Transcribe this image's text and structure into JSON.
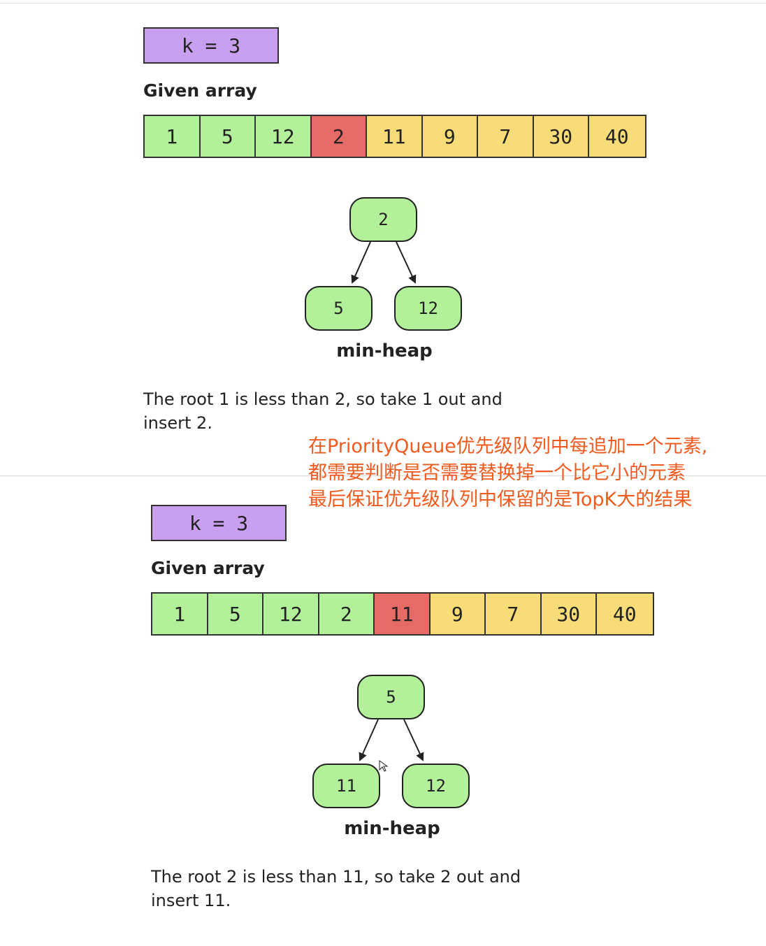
{
  "panels": [
    {
      "k_label": "k = 3",
      "given_label": "Given array",
      "array": [
        {
          "value": "1",
          "color": "green"
        },
        {
          "value": "5",
          "color": "green"
        },
        {
          "value": "12",
          "color": "green"
        },
        {
          "value": "2",
          "color": "red"
        },
        {
          "value": "11",
          "color": "yellow"
        },
        {
          "value": "9",
          "color": "yellow"
        },
        {
          "value": "7",
          "color": "yellow"
        },
        {
          "value": "30",
          "color": "yellow"
        },
        {
          "value": "40",
          "color": "yellow"
        }
      ],
      "heap": {
        "root": "2",
        "left": "5",
        "right": "12",
        "caption": "min-heap"
      },
      "description_line1": "The root 1 is less than 2, so take 1 out and",
      "description_line2": "insert 2."
    },
    {
      "k_label": "k = 3",
      "given_label": "Given array",
      "array": [
        {
          "value": "1",
          "color": "green"
        },
        {
          "value": "5",
          "color": "green"
        },
        {
          "value": "12",
          "color": "green"
        },
        {
          "value": "2",
          "color": "green"
        },
        {
          "value": "11",
          "color": "red"
        },
        {
          "value": "9",
          "color": "yellow"
        },
        {
          "value": "7",
          "color": "yellow"
        },
        {
          "value": "30",
          "color": "yellow"
        },
        {
          "value": "40",
          "color": "yellow"
        }
      ],
      "heap": {
        "root": "5",
        "left": "11",
        "right": "12",
        "caption": "min-heap"
      },
      "description_line1": "The root 2 is less than 11, so take 2 out and",
      "description_line2": "insert 11."
    }
  ],
  "annotation": {
    "lines": [
      "在PriorityQueue优先级队列中每追加一个元素,",
      "都需要判断是否需要替换掉一个比它小的元素",
      "最后保证优先级队列中保留的是TopK大的结果"
    ],
    "color": "#f05a1e"
  },
  "colors": {
    "green": "#b3f09a",
    "red": "#e66a66",
    "yellow": "#f7dc78",
    "purple": "#c9a0f0"
  }
}
